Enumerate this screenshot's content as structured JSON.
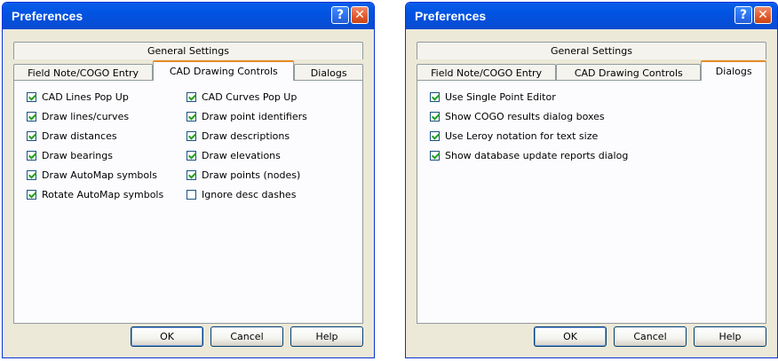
{
  "dialogs": [
    {
      "title": "Preferences",
      "tabs_back_row": [
        "General Settings"
      ],
      "tabs_front_row": [
        "Field Note/COGO Entry",
        "CAD Drawing Controls",
        "Dialogs"
      ],
      "active_tab": "CAD Drawing Controls",
      "checkbox_columns": [
        [
          {
            "label": "CAD Lines Pop Up",
            "checked": true
          },
          {
            "label": "Draw lines/curves",
            "checked": true
          },
          {
            "label": "Draw distances",
            "checked": true
          },
          {
            "label": "Draw bearings",
            "checked": true
          },
          {
            "label": "Draw AutoMap symbols",
            "checked": true
          },
          {
            "label": "Rotate AutoMap symbols",
            "checked": true
          }
        ],
        [
          {
            "label": "CAD Curves Pop Up",
            "checked": true
          },
          {
            "label": "Draw point identifiers",
            "checked": true
          },
          {
            "label": "Draw descriptions",
            "checked": true
          },
          {
            "label": "Draw elevations",
            "checked": true
          },
          {
            "label": "Draw points (nodes)",
            "checked": true
          },
          {
            "label": "Ignore desc dashes",
            "checked": false
          }
        ]
      ],
      "buttons": {
        "ok": "OK",
        "cancel": "Cancel",
        "help": "Help"
      }
    },
    {
      "title": "Preferences",
      "tabs_back_row": [
        "General Settings"
      ],
      "tabs_front_row": [
        "Field Note/COGO Entry",
        "CAD Drawing Controls",
        "Dialogs"
      ],
      "active_tab": "Dialogs",
      "checkboxes": [
        {
          "label": "Use Single Point Editor",
          "checked": true
        },
        {
          "label": "Show COGO results dialog boxes",
          "checked": true
        },
        {
          "label": "Use Leroy notation for text size",
          "checked": true
        },
        {
          "label": "Show database update reports dialog",
          "checked": true
        }
      ],
      "buttons": {
        "ok": "OK",
        "cancel": "Cancel",
        "help": "Help"
      }
    }
  ],
  "icons": {
    "help": "question-mark-icon",
    "close": "close-x-icon"
  },
  "colors": {
    "titlebar": "#0054E3",
    "dialog_bg": "#ECE9D8",
    "tab_highlight": "#E68B2C",
    "checkmark": "#21A121",
    "close_button": "#E05A2B"
  }
}
